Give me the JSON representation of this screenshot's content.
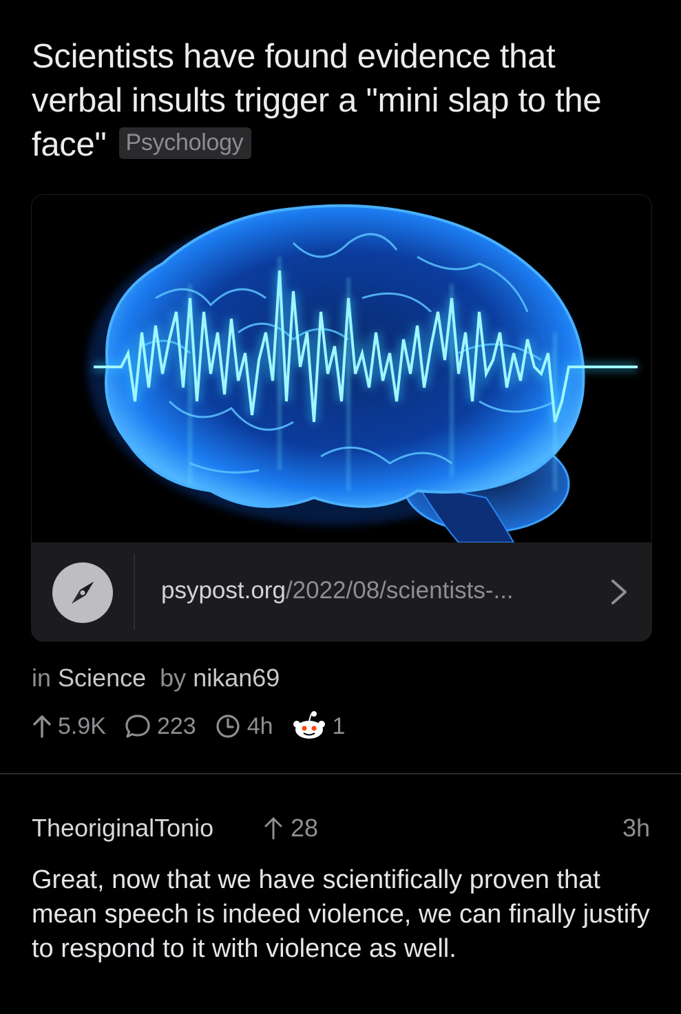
{
  "post": {
    "title": "Scientists have found evidence that verbal insults trigger a \"mini slap to the face\"",
    "flair": "Psychology"
  },
  "link": {
    "domain": "psypost.org",
    "path": "/2022/08/scientists-...",
    "image_description_icon": "brain-waveform-image"
  },
  "meta": {
    "in_label": "in",
    "subreddit": "Science",
    "by_label": "by",
    "author": "nikan69"
  },
  "stats": {
    "upvotes": "5.9K",
    "comments": "223",
    "age": "4h",
    "awards": "1"
  },
  "comment": {
    "author": "TheoriginalTonio",
    "score": "28",
    "time": "3h",
    "body": "Great, now that we have scientifically proven that mean speech is indeed violence, we can finally justify to respond to it with violence as well."
  },
  "colors": {
    "background": "#000000",
    "card": "#1c1c1e",
    "muted_text": "#8e8e93",
    "brain_blue": "#1e90ff",
    "wave_cyan": "#7ff3ff"
  }
}
